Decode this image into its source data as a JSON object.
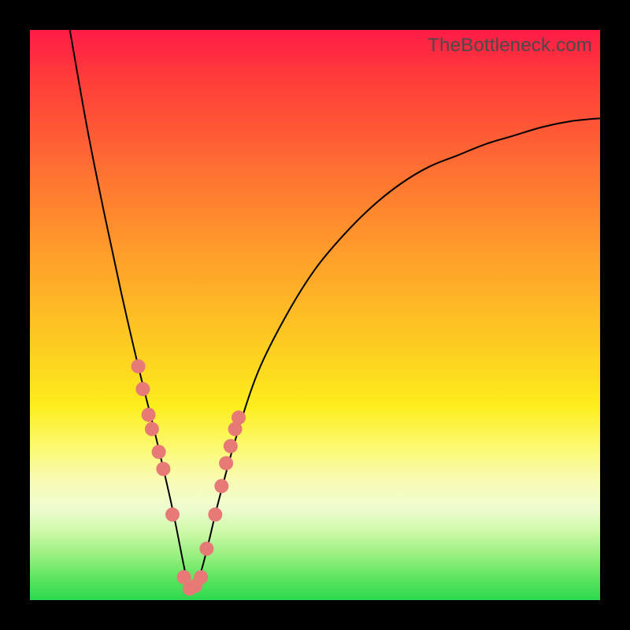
{
  "watermark": "TheBottleneck.com",
  "colors": {
    "frame_bg": "#000000",
    "gradient_top": "#ff1c47",
    "gradient_bottom": "#2bd94e",
    "curve": "#000000",
    "dots": "#e77a77"
  },
  "chart_data": {
    "type": "line",
    "title": "",
    "xlabel": "",
    "ylabel": "",
    "xlim": [
      0,
      100
    ],
    "ylim": [
      0,
      100
    ],
    "note": "Axes are normalized 0–100; no tick labels present in source. y is bottleneck percentage (lower is better). V-shaped curve with minimum near x≈28.",
    "series": [
      {
        "name": "bottleneck-curve",
        "x": [
          7,
          10,
          13,
          16,
          19,
          22,
          25,
          27,
          28,
          30,
          33,
          36,
          40,
          45,
          50,
          55,
          60,
          65,
          70,
          75,
          80,
          85,
          90,
          95,
          100
        ],
        "y": [
          100,
          83,
          68,
          54,
          41,
          29,
          16,
          6,
          2,
          5,
          17,
          28,
          40,
          50,
          58,
          64,
          69,
          73,
          76,
          78,
          80,
          81.5,
          83,
          84,
          84.5
        ]
      }
    ],
    "highlight_points": {
      "name": "dots",
      "x": [
        19.0,
        19.8,
        20.8,
        21.4,
        22.6,
        23.4,
        25.0,
        27.0,
        28.0,
        29.0,
        30.0,
        31.0,
        32.5,
        33.6,
        34.4,
        35.2,
        36.0,
        36.6
      ],
      "y": [
        41.0,
        37.0,
        32.5,
        30.0,
        26.0,
        23.0,
        15.0,
        4.0,
        2.0,
        2.5,
        4.0,
        9.0,
        15.0,
        20.0,
        24.0,
        27.0,
        30.0,
        32.0
      ]
    }
  }
}
